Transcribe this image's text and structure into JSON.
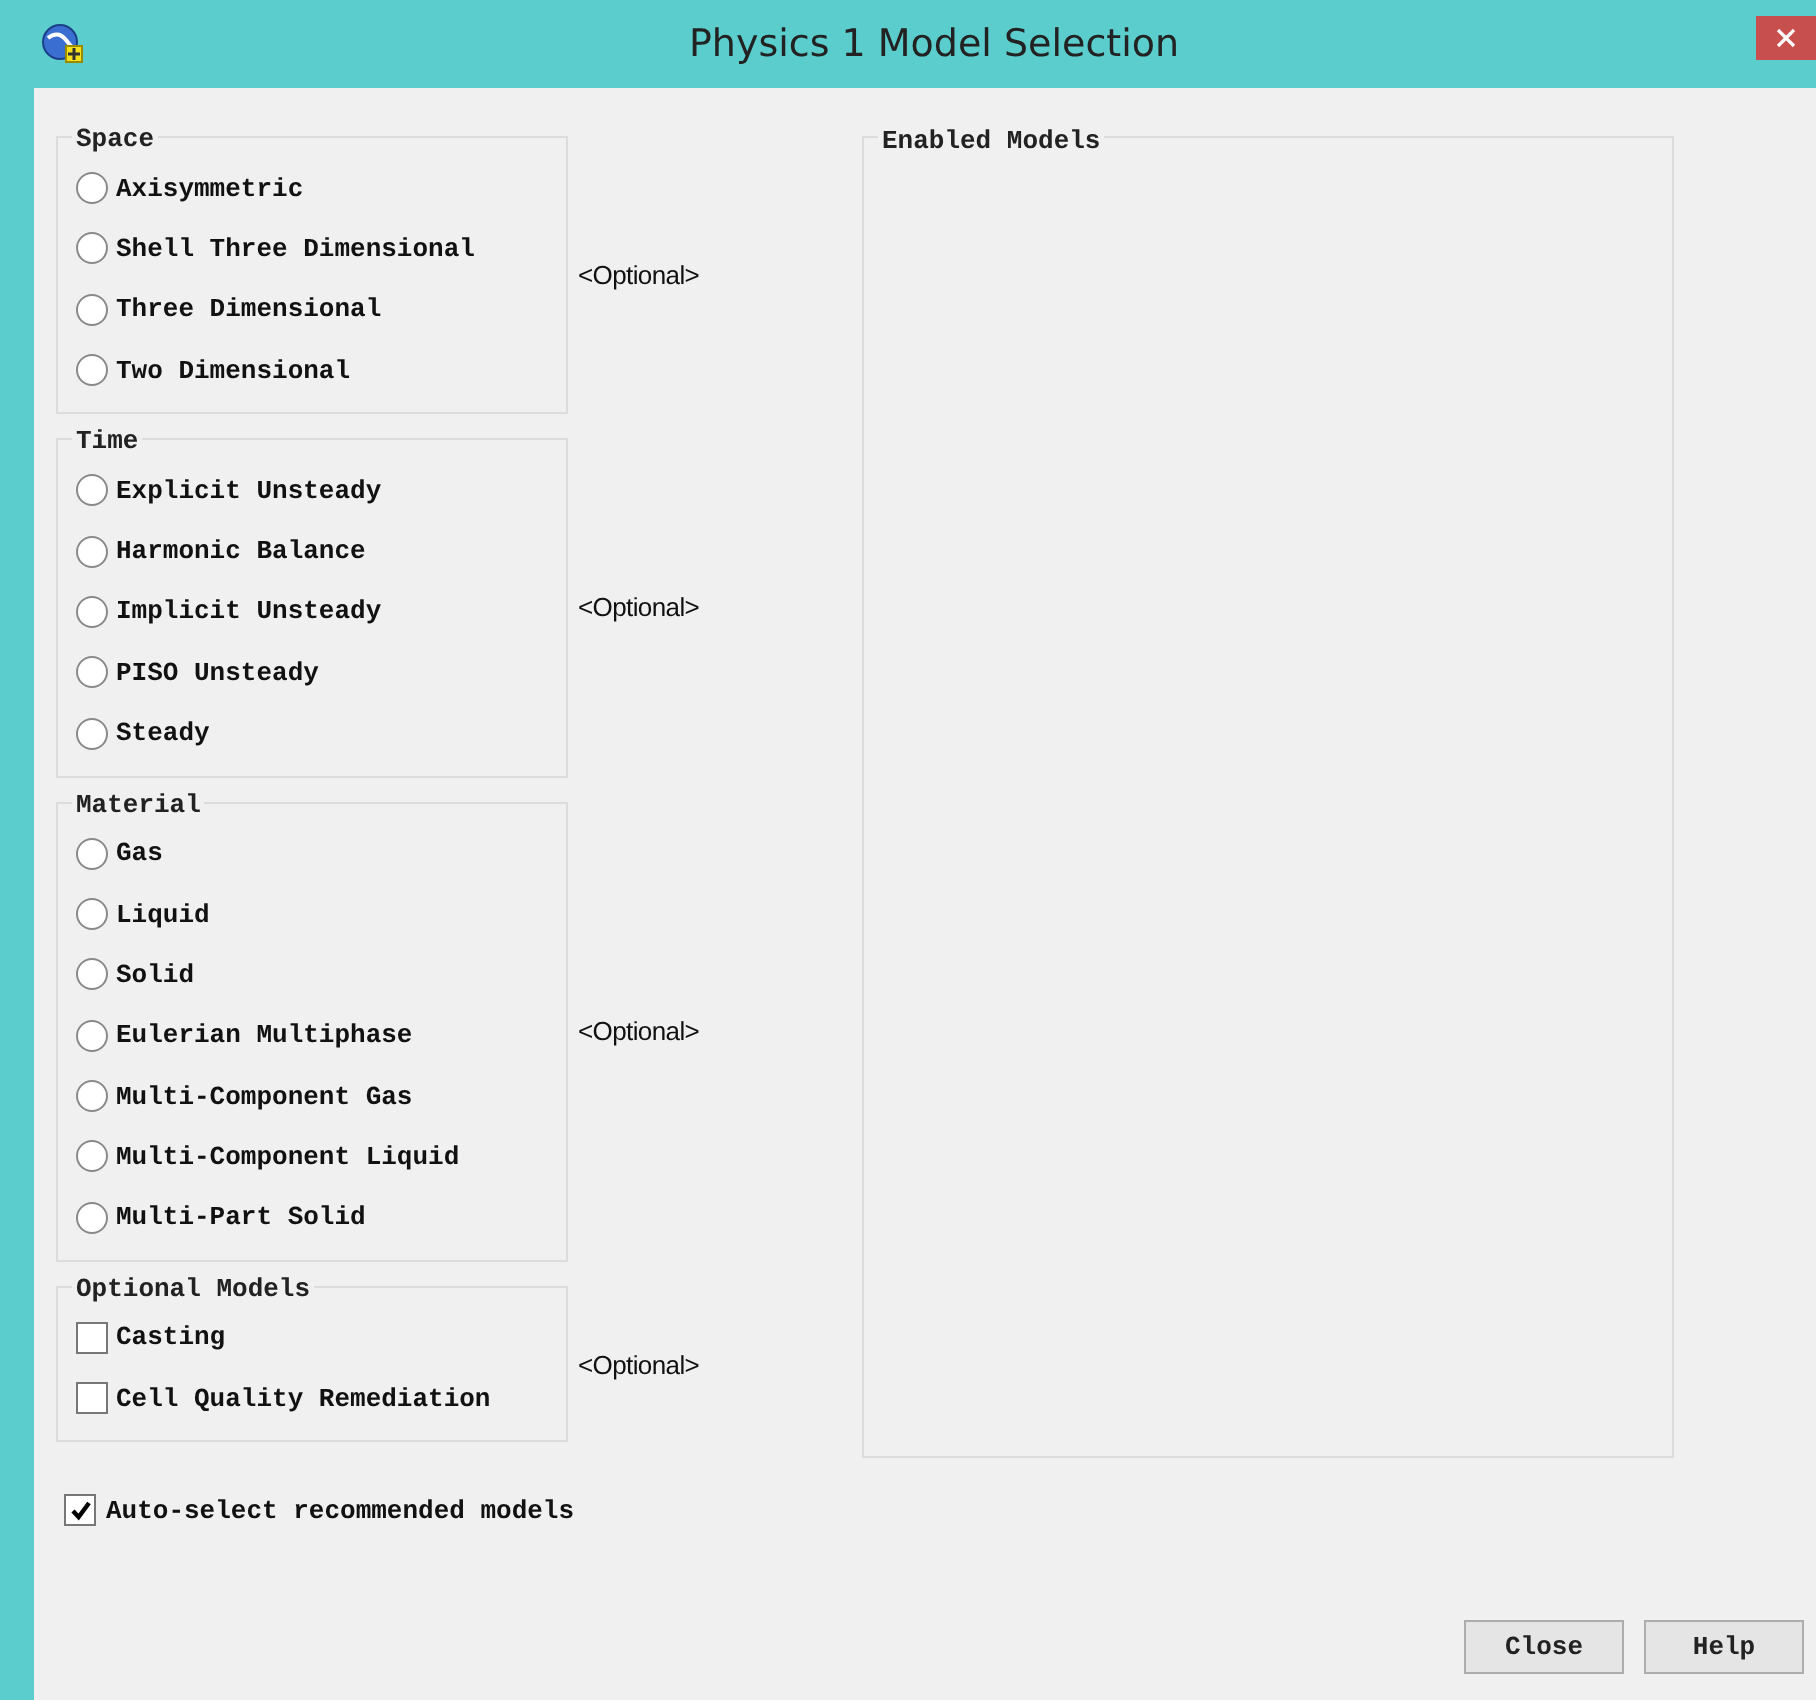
{
  "window": {
    "title": "Physics 1 Model Selection"
  },
  "groups": [
    {
      "title": "Space",
      "kind": "radio",
      "note": "<Optional>",
      "items": [
        {
          "label": "Axisymmetric",
          "selected": false
        },
        {
          "label": "Shell Three Dimensional",
          "selected": false
        },
        {
          "label": "Three Dimensional",
          "selected": false
        },
        {
          "label": "Two Dimensional",
          "selected": false
        }
      ]
    },
    {
      "title": "Time",
      "kind": "radio",
      "note": "<Optional>",
      "items": [
        {
          "label": "Explicit Unsteady",
          "selected": false
        },
        {
          "label": "Harmonic Balance",
          "selected": false
        },
        {
          "label": "Implicit Unsteady",
          "selected": false
        },
        {
          "label": "PISO Unsteady",
          "selected": false
        },
        {
          "label": "Steady",
          "selected": false
        }
      ]
    },
    {
      "title": "Material",
      "kind": "radio",
      "note": "<Optional>",
      "items": [
        {
          "label": "Gas",
          "selected": false
        },
        {
          "label": "Liquid",
          "selected": false
        },
        {
          "label": "Solid",
          "selected": false
        },
        {
          "label": "Eulerian Multiphase",
          "selected": false
        },
        {
          "label": "Multi-Component Gas",
          "selected": false
        },
        {
          "label": "Multi-Component Liquid",
          "selected": false
        },
        {
          "label": "Multi-Part Solid",
          "selected": false
        }
      ]
    },
    {
      "title": "Optional Models",
      "kind": "checkbox",
      "note": "<Optional>",
      "items": [
        {
          "label": "Casting",
          "checked": false
        },
        {
          "label": "Cell Quality Remediation",
          "checked": false
        }
      ]
    }
  ],
  "enabled_models": {
    "title": "Enabled Models"
  },
  "auto_select": {
    "label": "Auto-select recommended models",
    "checked": true
  },
  "buttons": [
    "Close",
    "Help"
  ]
}
